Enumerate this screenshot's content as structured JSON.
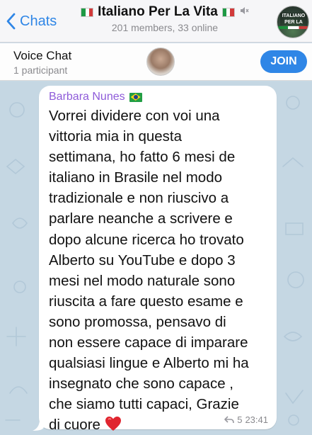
{
  "header": {
    "back_label": "Chats",
    "title": "Italiano Per La Vita",
    "subtitle": "201 members, 33 online",
    "avatar_text": "ITALIANO PER LA"
  },
  "voice_chat": {
    "title": "Voice Chat",
    "participants": "1 participant",
    "join_label": "JOIN"
  },
  "message": {
    "sender": "Barbara Nunes",
    "text": "Vorrei dividere con voi una\nvittoria mia in questa\nsettimana, ho fatto 6 mesi de\nitaliano in Brasile nel modo\ntradizionale e non riuscivo a\nparlare neanche a scrivere e\ndopo alcune ricerca ho trovato\nAlberto su YouTube e dopo 3\nmesi nel modo naturale sono\nriuscita a fare questo esame e\nsono promossa, pensavo di\nnon essere capace di imparare\nqualsiasi lingue e Alberto mi ha\ninsegnato che sono capace ,\nche siamo tutti capaci, Grazie\ndi cuore ",
    "replies": "5",
    "time": "23:41"
  },
  "colors": {
    "accent": "#2f86e6",
    "sender": "#8e5bd9",
    "chat_bg": "#c5d7e3"
  },
  "icons": [
    "chevron-left-icon",
    "italy-flag-icon",
    "mute-icon",
    "brazil-flag-icon",
    "heart-emoji-icon",
    "reply-icon"
  ]
}
